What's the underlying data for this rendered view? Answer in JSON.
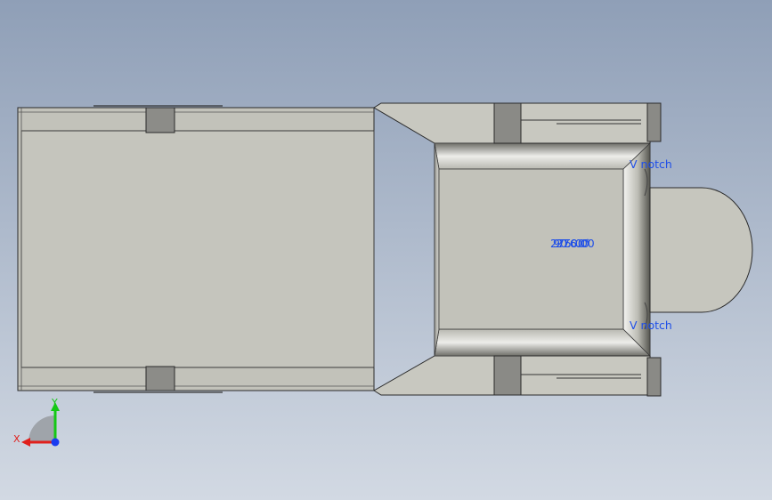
{
  "viewport": {
    "background_top": "#8f9fb7",
    "background_bottom": "#d2d9e3"
  },
  "annotations": {
    "notch_top": "V notch",
    "notch_bottom": "V notch",
    "dimension_values": [
      "275.00",
      "90.00°",
      "276.00"
    ]
  },
  "triad": {
    "x_label": "X",
    "y_label": "Y",
    "colors": {
      "x": "#e0201c",
      "y": "#14c814",
      "z": "#1a3cf0"
    }
  },
  "colors": {
    "face": "#c1c1b9",
    "face_dark": "#8f8f88",
    "edge": "#2a2a2a",
    "block": "#8a8a86",
    "annotation": "#1f4fe8"
  }
}
